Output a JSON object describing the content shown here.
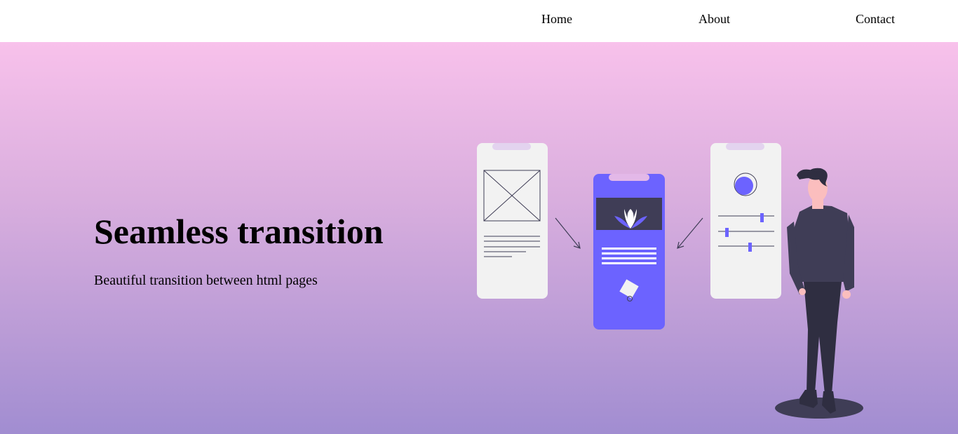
{
  "nav": {
    "items": [
      {
        "label": "Home"
      },
      {
        "label": "About"
      },
      {
        "label": "Contact"
      }
    ]
  },
  "hero": {
    "title": "Seamless transition",
    "subtitle": "Beautiful transition between html pages",
    "illustration": {
      "icons": [
        "image-placeholder-icon",
        "lotus-icon",
        "avatar-circle-icon",
        "slider-icon",
        "person-figure"
      ],
      "colors": {
        "accent": "#6c63ff",
        "screen": "#f2f2f2",
        "dark": "#3f3d56"
      }
    }
  },
  "colors": {
    "gradient_top": "#f8c1eb",
    "gradient_bottom": "#a18dd1",
    "nav_background": "#ffffff"
  }
}
